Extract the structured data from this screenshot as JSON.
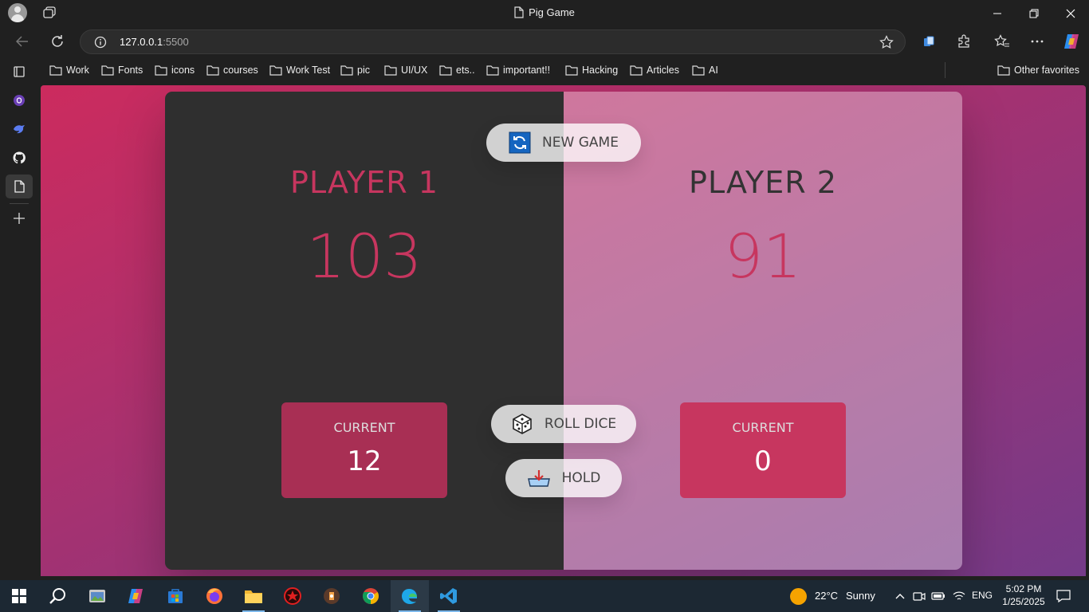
{
  "browser": {
    "tab_title": "Pig Game",
    "url_host": "127.0.0.1",
    "url_port": ":5500"
  },
  "favorites": [
    {
      "label": "Work"
    },
    {
      "label": "Fonts"
    },
    {
      "label": "icons"
    },
    {
      "label": "courses"
    },
    {
      "label": "Work Test"
    },
    {
      "label": "pic"
    },
    {
      "label": "UI/UX"
    },
    {
      "label": "ets.."
    },
    {
      "label": "important!!"
    },
    {
      "label": "Hacking"
    },
    {
      "label": "Articles"
    },
    {
      "label": "AI"
    }
  ],
  "other_favorites": "Other favorites",
  "game": {
    "new_game_label": "NEW GAME",
    "roll_dice_label": "ROLL DICE",
    "hold_label": "HOLD",
    "player1": {
      "name": "PLAYER 1",
      "score": "103",
      "current_label": "CURRENT",
      "current_value": "12",
      "active": true
    },
    "player2": {
      "name": "PLAYER 2",
      "score": "91",
      "current_label": "CURRENT",
      "current_value": "0",
      "active": false
    }
  },
  "taskbar": {
    "weather_temp": "22°C",
    "weather_desc": "Sunny",
    "language": "ENG",
    "time": "5:02 PM",
    "date": "1/25/2025"
  },
  "colors": {
    "accent": "#c7365f",
    "gradient_start": "#cc2b5e",
    "gradient_end": "#753a88"
  }
}
